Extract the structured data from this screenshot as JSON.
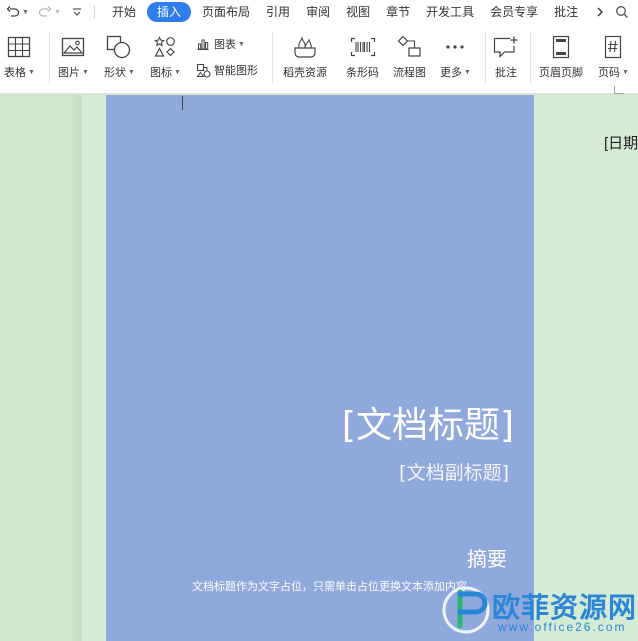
{
  "quick_access": {
    "undo_icon": "undo-icon",
    "redo_icon": "redo-icon",
    "customize_icon": "customize-quick-access-icon"
  },
  "tabs": [
    {
      "label": "开始"
    },
    {
      "label": "插入",
      "active": true
    },
    {
      "label": "页面布局"
    },
    {
      "label": "引用"
    },
    {
      "label": "审阅"
    },
    {
      "label": "视图"
    },
    {
      "label": "章节"
    },
    {
      "label": "开发工具"
    },
    {
      "label": "会员专享"
    },
    {
      "label": "批注"
    }
  ],
  "ribbon": {
    "table": "表格",
    "picture": "图片",
    "shape": "形状",
    "icon": "图标",
    "chart": "图表",
    "smart_art": "智能图形",
    "daoke": "稻壳资源",
    "barcode": "条形码",
    "flowchart": "流程图",
    "more": "更多",
    "comment": "批注",
    "header_footer": "页眉页脚",
    "page_number": "页码"
  },
  "document": {
    "date": "[日期",
    "title": "[文档标题]",
    "subtitle": "[文档副标题]",
    "abstract_title": "摘要",
    "abstract_body": "文档标题作为文字占位，只需单击占位更换文本添加内容"
  },
  "watermark": {
    "name": "欧菲资源网",
    "url": "www.office26.com"
  },
  "colors": {
    "accent": "#2f7dea",
    "cover": "#8fa9dc",
    "page": "#d6ebd3",
    "background": "#cfe6cc",
    "watermark": "#2b86d8"
  }
}
